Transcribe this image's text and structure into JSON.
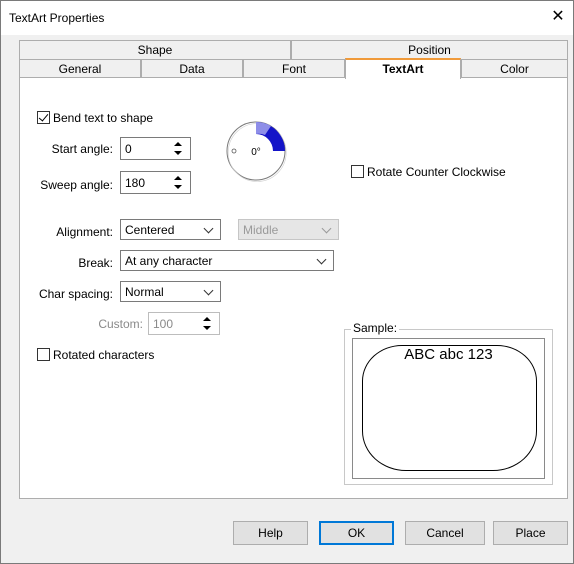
{
  "window": {
    "title": "TextArt Properties",
    "close_glyph": "✕"
  },
  "tabs_row1": [
    {
      "label": "Shape"
    },
    {
      "label": "Position"
    }
  ],
  "tabs_row2": [
    {
      "label": "General"
    },
    {
      "label": "Data"
    },
    {
      "label": "Font"
    },
    {
      "label": "TextArt",
      "active": true
    },
    {
      "label": "Color"
    }
  ],
  "textart": {
    "bend_label": "Bend text to shape",
    "bend_checked": true,
    "start_angle_label": "Start angle:",
    "start_angle_value": "0",
    "sweep_angle_label": "Sweep angle:",
    "sweep_angle_value": "180",
    "dial_label": "0°",
    "rotate_ccw_label": "Rotate Counter Clockwise",
    "rotate_ccw_checked": false,
    "alignment_label": "Alignment:",
    "alignment_value": "Centered",
    "vertical_value": "Middle",
    "break_label": "Break:",
    "break_value": "At any character",
    "char_spacing_label": "Char spacing:",
    "char_spacing_value": "Normal",
    "custom_label": "Custom:",
    "custom_value": "100",
    "rotated_chars_label": "Rotated characters",
    "rotated_chars_checked": false,
    "sample_label": "Sample:",
    "sample_text": "ABC abc 123"
  },
  "buttons": {
    "help": "Help",
    "ok": "OK",
    "cancel": "Cancel",
    "place": "Place"
  },
  "colors": {
    "accent": "#0078d7",
    "tab_highlight": "#f09a3a",
    "dial_arc": "#1010d0"
  }
}
